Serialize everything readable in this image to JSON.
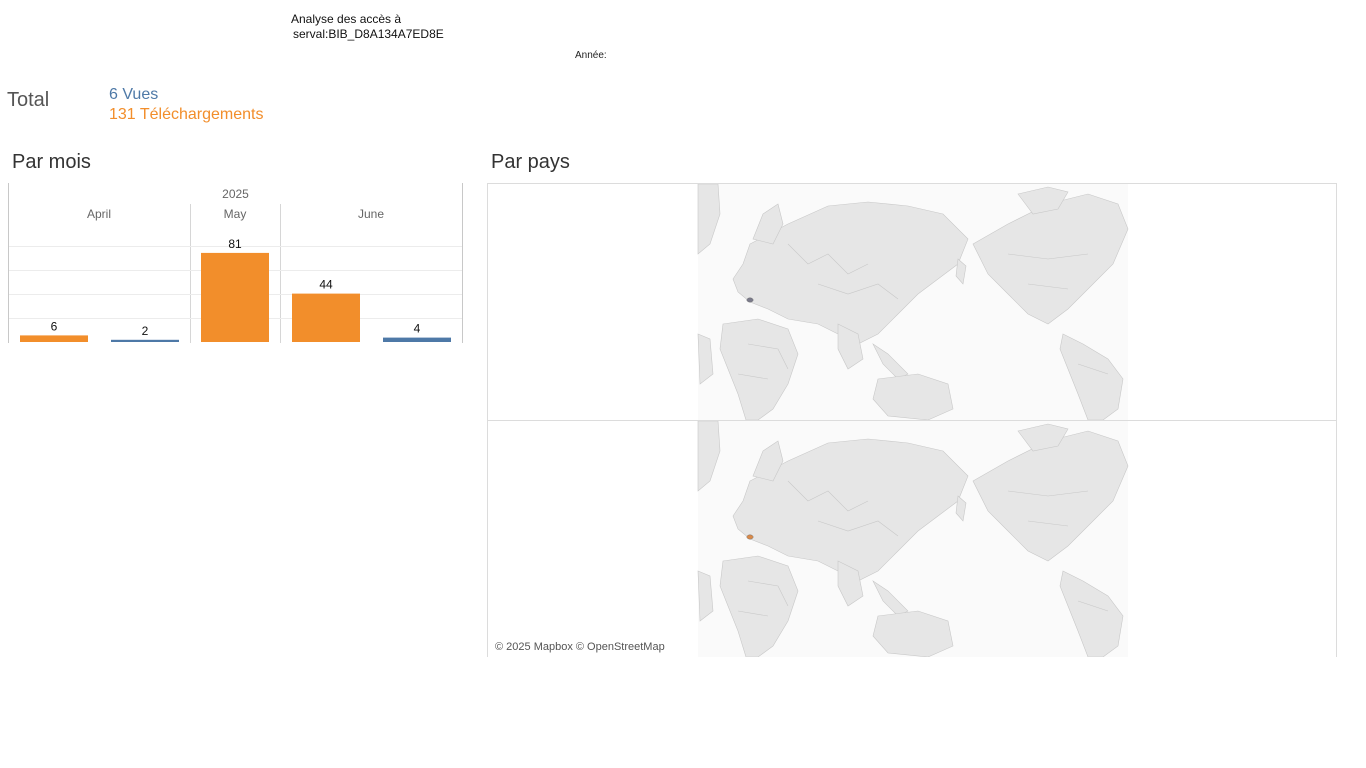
{
  "header": {
    "title_line1": "Analyse des accès à",
    "title_line2": "serval:BIB_D8A134A7ED8E",
    "year_filter_label": "Année:"
  },
  "totals": {
    "label": "Total",
    "vues": "6 Vues",
    "telechargements": "131 Téléchargements"
  },
  "sections": {
    "par_mois": "Par mois",
    "par_pays": "Par pays"
  },
  "colors": {
    "telechargements": "#f28e2b",
    "vues": "#4e79a7",
    "land": "#e6e6e6",
    "border": "#c8c8c8"
  },
  "chart_data": {
    "type": "bar",
    "title": "Par mois",
    "year": "2025",
    "months": [
      "April",
      "May",
      "June"
    ],
    "ylim": [
      0,
      90
    ],
    "grid": true,
    "series": [
      {
        "name": "Téléchargements",
        "color": "#f28e2b",
        "values": [
          6,
          81,
          44
        ]
      },
      {
        "name": "Vues",
        "color": "#4e79a7",
        "values": [
          2,
          null,
          4
        ]
      }
    ],
    "bars": [
      {
        "month": "April",
        "series": "Téléchargements",
        "value": 6
      },
      {
        "month": "April",
        "series": "Vues",
        "value": 2
      },
      {
        "month": "May",
        "series": "Téléchargements",
        "value": 81
      },
      {
        "month": "June",
        "series": "Téléchargements",
        "value": 44
      },
      {
        "month": "June",
        "series": "Vues",
        "value": 4
      }
    ]
  },
  "map": {
    "attribution": "© 2025 Mapbox © OpenStreetMap",
    "panels": [
      {
        "series": "Vues",
        "highlight_color": "#7a7a8a"
      },
      {
        "series": "Téléchargements",
        "highlight_color": "#d98a4a"
      }
    ]
  }
}
